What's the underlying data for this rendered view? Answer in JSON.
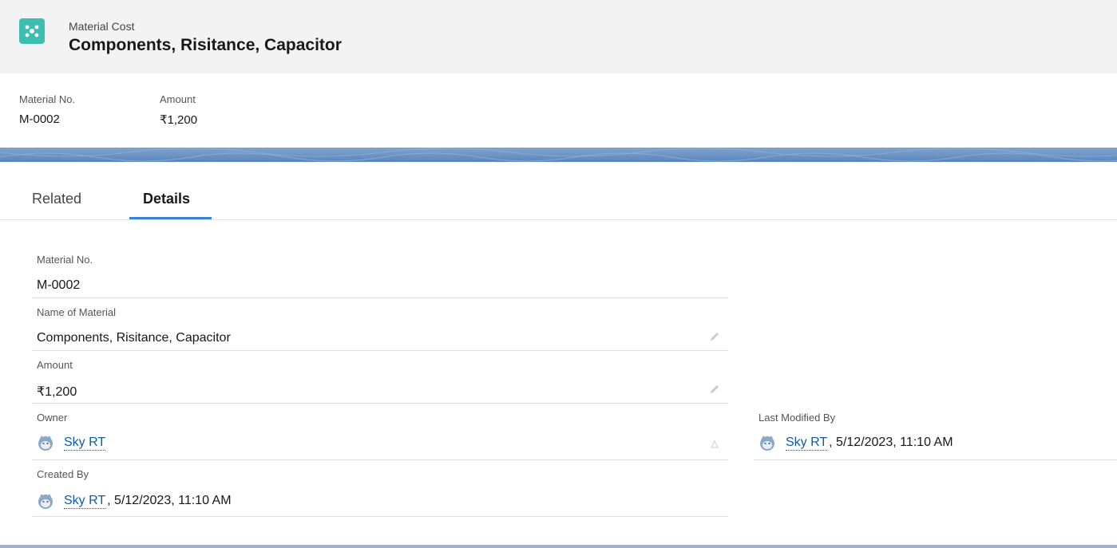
{
  "header": {
    "object_label": "Material Cost",
    "title": "Components, Risitance, Capacitor",
    "icon": "material-cost-icon",
    "icon_color": "#3bbfb0"
  },
  "highlights": [
    {
      "label": "Material No.",
      "value": "M-0002"
    },
    {
      "label": "Amount",
      "value": "₹1,200"
    }
  ],
  "tabs": {
    "related": "Related",
    "details": "Details",
    "active": "Details",
    "accent_color": "#3b82d6"
  },
  "details": {
    "material_no": {
      "label": "Material No.",
      "value": "M-0002"
    },
    "name": {
      "label": "Name of Material",
      "value": "Components, Risitance, Capacitor"
    },
    "amount": {
      "label": "Amount",
      "value": "₹1,200"
    },
    "owner": {
      "label": "Owner",
      "user": "Sky RT"
    },
    "created_by": {
      "label": "Created By",
      "user": "Sky RT",
      "date": ", 5/12/2023, 11:10 AM"
    },
    "last_modified_by": {
      "label": "Last Modified By",
      "user": "Sky RT",
      "date": ", 5/12/2023, 11:10 AM"
    }
  },
  "colors": {
    "link": "#0b5cab",
    "header_bg": "#f3f3f3"
  }
}
